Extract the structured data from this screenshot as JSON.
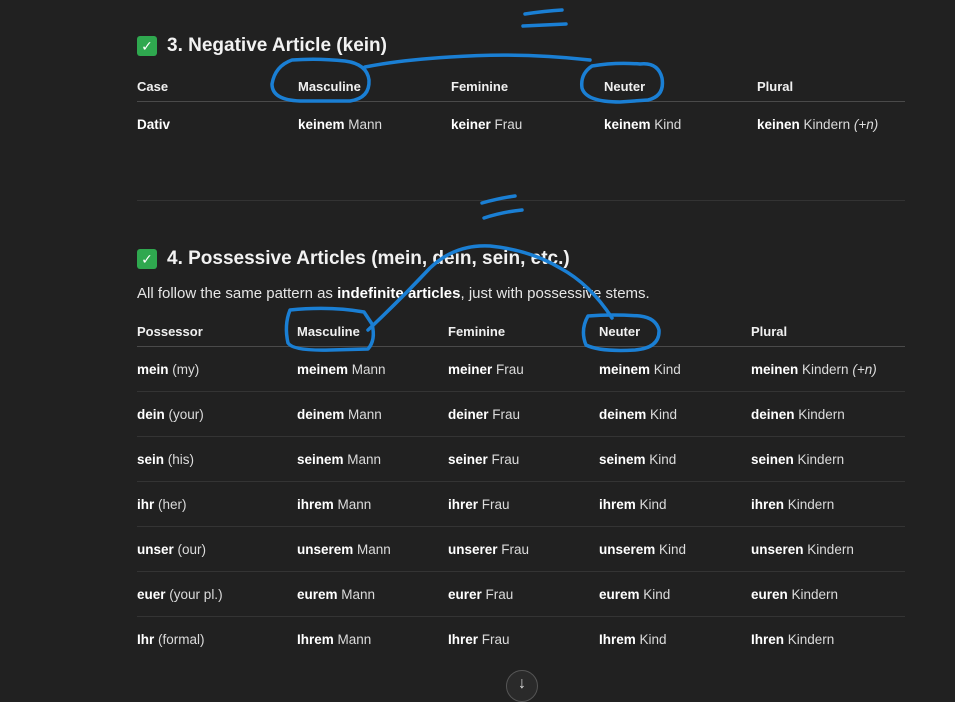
{
  "section3": {
    "check_icon": "✓",
    "title": "3. Negative Article (kein)",
    "headers": [
      "Case",
      "Masculine",
      "Feminine",
      "Neuter",
      "Plural"
    ],
    "row": {
      "case": "Dativ",
      "masc_bold": "keinem",
      "masc_rest": "Mann",
      "fem_bold": "keiner",
      "fem_rest": "Frau",
      "neut_bold": "keinem",
      "neut_rest": "Kind",
      "pl_bold": "keinen",
      "pl_rest": "Kindern",
      "pl_note": "(+n)"
    }
  },
  "section4": {
    "check_icon": "✓",
    "title": "4. Possessive Articles (mein, dein, sein, etc.)",
    "intro_pre": "All follow the same pattern as",
    "intro_bold": "indefinite articles",
    "intro_post": ", just with possessive stems.",
    "headers": [
      "Possessor",
      "Masculine",
      "Feminine",
      "Neuter",
      "Plural"
    ],
    "rows": [
      {
        "p_bold": "mein",
        "p_rest": "(my)",
        "m_bold": "meinem",
        "m_rest": "Mann",
        "f_bold": "meiner",
        "f_rest": "Frau",
        "n_bold": "meinem",
        "n_rest": "Kind",
        "pl_bold": "meinen",
        "pl_rest": "Kindern",
        "pl_note": "(+n)"
      },
      {
        "p_bold": "dein",
        "p_rest": "(your)",
        "m_bold": "deinem",
        "m_rest": "Mann",
        "f_bold": "deiner",
        "f_rest": "Frau",
        "n_bold": "deinem",
        "n_rest": "Kind",
        "pl_bold": "deinen",
        "pl_rest": "Kindern",
        "pl_note": ""
      },
      {
        "p_bold": "sein",
        "p_rest": "(his)",
        "m_bold": "seinem",
        "m_rest": "Mann",
        "f_bold": "seiner",
        "f_rest": "Frau",
        "n_bold": "seinem",
        "n_rest": "Kind",
        "pl_bold": "seinen",
        "pl_rest": "Kindern",
        "pl_note": ""
      },
      {
        "p_bold": "ihr",
        "p_rest": "(her)",
        "m_bold": "ihrem",
        "m_rest": "Mann",
        "f_bold": "ihrer",
        "f_rest": "Frau",
        "n_bold": "ihrem",
        "n_rest": "Kind",
        "pl_bold": "ihren",
        "pl_rest": "Kindern",
        "pl_note": ""
      },
      {
        "p_bold": "unser",
        "p_rest": "(our)",
        "m_bold": "unserem",
        "m_rest": "Mann",
        "f_bold": "unserer",
        "f_rest": "Frau",
        "n_bold": "unserem",
        "n_rest": "Kind",
        "pl_bold": "unseren",
        "pl_rest": "Kindern",
        "pl_note": ""
      },
      {
        "p_bold": "euer",
        "p_rest": "(your pl.)",
        "m_bold": "eurem",
        "m_rest": "Mann",
        "f_bold": "eurer",
        "f_rest": "Frau",
        "n_bold": "eurem",
        "n_rest": "Kind",
        "pl_bold": "euren",
        "pl_rest": "Kindern",
        "pl_note": ""
      },
      {
        "p_bold": "Ihr",
        "p_rest": "(formal)",
        "m_bold": "Ihrem",
        "m_rest": "Mann",
        "f_bold": "Ihrer",
        "f_rest": "Frau",
        "n_bold": "Ihrem",
        "n_rest": "Kind",
        "pl_bold": "Ihren",
        "pl_rest": "Kindern",
        "pl_note": ""
      }
    ]
  },
  "scroll_button": {
    "icon": "arrow-down-icon",
    "glyph": "↓"
  },
  "colors": {
    "annotation": "#1a7fd4",
    "check": "#2fa84f",
    "background": "#212121"
  }
}
